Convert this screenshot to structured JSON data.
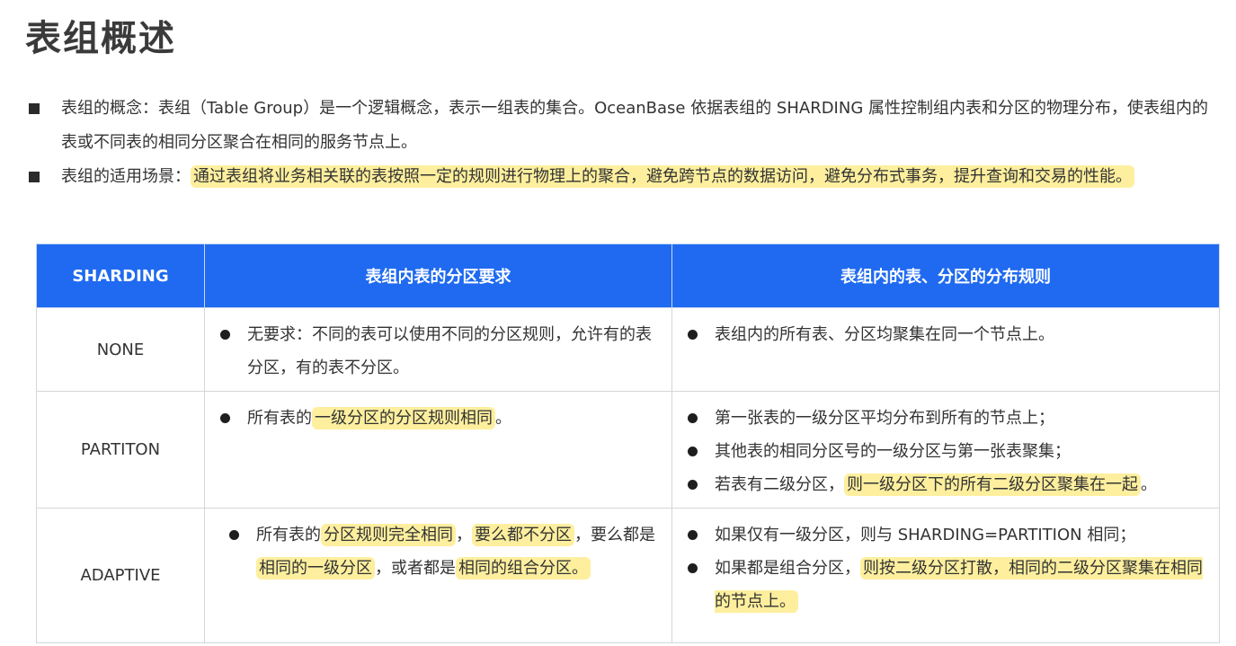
{
  "title": "表组概述",
  "bullets": {
    "item1": "表组的概念：表组（Table Group）是一个逻辑概念，表示一组表的集合。OceanBase 依据表组的 SHARDING 属性控制组内表和分区的物理分布，使表组内的表或不同表的相同分区聚合在相同的服务节点上。",
    "item2_prefix": "表组的适用场景：",
    "item2_highlight": "通过表组将业务相关联的表按照一定的规则进行物理上的聚合，避免跨节点的数据访问，避免分布式事务，提升查询和交易的性能。"
  },
  "table": {
    "headers": [
      "SHARDING",
      "表组内表的分区要求",
      "表组内的表、分区的分布规则"
    ],
    "rows": [
      {
        "key": "NONE",
        "req": "无要求：不同的表可以使用不同的分区规则，允许有的表分区，有的表不分区。",
        "dist": "表组内的所有表、分区均聚集在同一个节点上。"
      },
      {
        "key": "PARTITON",
        "req_a": "所有表的",
        "req_hl": "一级分区的分区规则相同",
        "req_b": "。",
        "dist1": "第一张表的一级分区平均分布到所有的节点上；",
        "dist2": "其他表的相同分区号的一级分区与第一张表聚集；",
        "dist3_a": "若表有二级分区，",
        "dist3_hl": "则一级分区下的所有二级分区聚集在一起",
        "dist3_b": "。"
      },
      {
        "key": "ADAPTIVE",
        "req_a": "所有表的",
        "req_hl1": "分区规则完全相同",
        "req_b": "，",
        "req_hl2": "要么都不分区",
        "req_c": "，要么都是",
        "req_hl3": "相同的一级分区",
        "req_d": "，或者都是",
        "req_hl4": "相同的组合分区。",
        "dist1": "如果仅有一级分区，则与 SHARDING=PARTITION 相同；",
        "dist2_a": "如果都是组合分区，",
        "dist2_hl": "则按二级分区打散，相同的二级分区聚集在相同的节点上。"
      }
    ]
  },
  "colors": {
    "header_bg": "#1f6af0",
    "highlight": "#fdef9e"
  }
}
